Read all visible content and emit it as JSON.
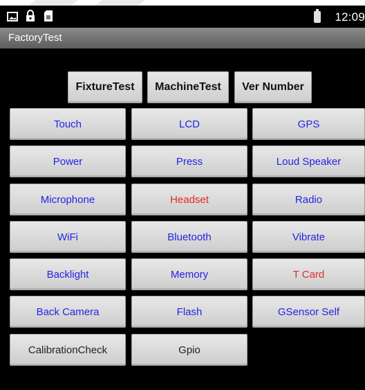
{
  "status_bar": {
    "time": "12:09",
    "icons": [
      "image-icon",
      "lock-icon",
      "sim-card-icon",
      "battery-icon"
    ]
  },
  "app": {
    "title": "FactoryTest"
  },
  "top_buttons": [
    {
      "label": "FixtureTest"
    },
    {
      "label": "MachineTest"
    },
    {
      "label": "Ver Number"
    }
  ],
  "tests": [
    {
      "label": "Touch",
      "color": "#2323e6"
    },
    {
      "label": "LCD",
      "color": "#2323e6"
    },
    {
      "label": "GPS",
      "color": "#2323e6"
    },
    {
      "label": "Power",
      "color": "#2323e6"
    },
    {
      "label": "Press",
      "color": "#2323e6"
    },
    {
      "label": "Loud Speaker",
      "color": "#2323e6"
    },
    {
      "label": "Microphone",
      "color": "#2323e6"
    },
    {
      "label": "Headset",
      "color": "#e12a2a"
    },
    {
      "label": "Radio",
      "color": "#2323e6"
    },
    {
      "label": "WiFi",
      "color": "#2323e6"
    },
    {
      "label": "Bluetooth",
      "color": "#2323e6"
    },
    {
      "label": "Vibrate",
      "color": "#2323e6"
    },
    {
      "label": "Backlight",
      "color": "#2323e6"
    },
    {
      "label": "Memory",
      "color": "#2323e6"
    },
    {
      "label": "T Card",
      "color": "#e12a2a"
    },
    {
      "label": "Back Camera",
      "color": "#2323e6"
    },
    {
      "label": "Flash",
      "color": "#2323e6"
    },
    {
      "label": "GSensor Self",
      "color": "#2323e6"
    },
    {
      "label": "CalibrationCheck",
      "color": "#222222"
    },
    {
      "label": "Gpio",
      "color": "#222222"
    }
  ]
}
